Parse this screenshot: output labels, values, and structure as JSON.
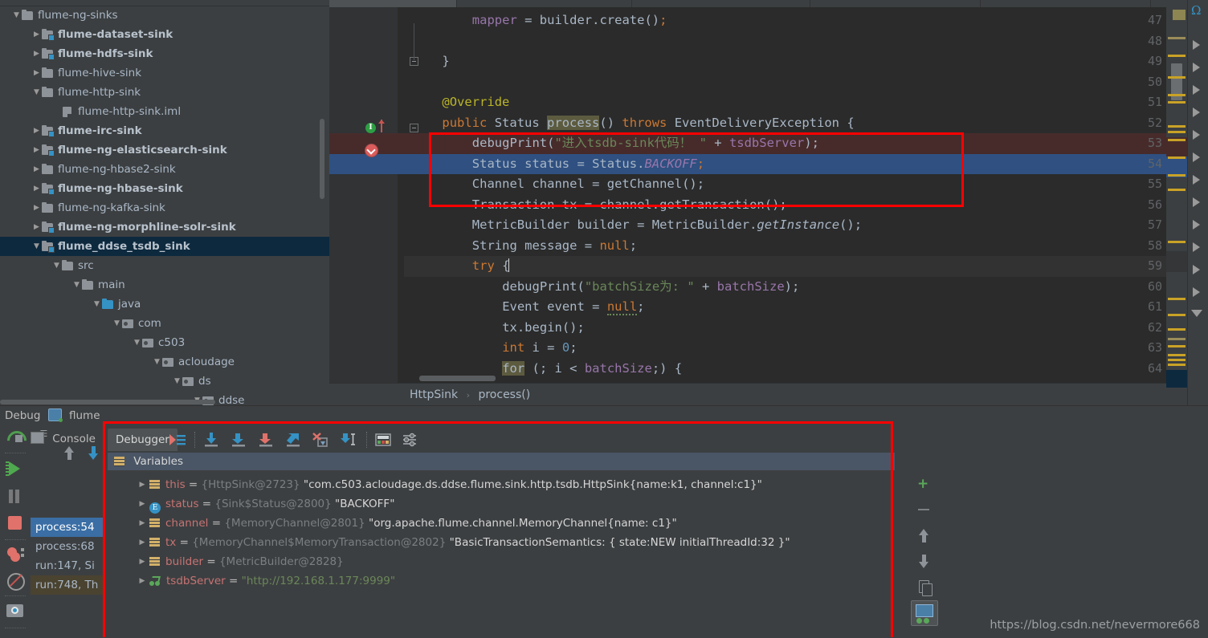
{
  "project_tree": {
    "items": [
      {
        "label": "flume-ng-sinks",
        "indent": 0,
        "twisty": "▼",
        "icon": "folder",
        "bold": false
      },
      {
        "label": "flume-dataset-sink",
        "indent": 1,
        "twisty": "▶",
        "icon": "module",
        "bold": true
      },
      {
        "label": "flume-hdfs-sink",
        "indent": 1,
        "twisty": "▶",
        "icon": "module",
        "bold": true
      },
      {
        "label": "flume-hive-sink",
        "indent": 1,
        "twisty": "▶",
        "icon": "folder",
        "bold": false
      },
      {
        "label": "flume-http-sink",
        "indent": 1,
        "twisty": "▼",
        "icon": "folder",
        "bold": false
      },
      {
        "label": "flume-http-sink.iml",
        "indent": 2,
        "twisty": "",
        "icon": "iml",
        "bold": false
      },
      {
        "label": "flume-irc-sink",
        "indent": 1,
        "twisty": "▶",
        "icon": "module",
        "bold": true
      },
      {
        "label": "flume-ng-elasticsearch-sink",
        "indent": 1,
        "twisty": "▶",
        "icon": "module",
        "bold": true
      },
      {
        "label": "flume-ng-hbase2-sink",
        "indent": 1,
        "twisty": "▶",
        "icon": "folder",
        "bold": false
      },
      {
        "label": "flume-ng-hbase-sink",
        "indent": 1,
        "twisty": "▶",
        "icon": "module",
        "bold": true
      },
      {
        "label": "flume-ng-kafka-sink",
        "indent": 1,
        "twisty": "▶",
        "icon": "folder",
        "bold": false
      },
      {
        "label": "flume-ng-morphline-solr-sink",
        "indent": 1,
        "twisty": "▶",
        "icon": "module",
        "bold": true
      },
      {
        "label": "flume_ddse_tsdb_sink",
        "indent": 1,
        "twisty": "▼",
        "icon": "module",
        "bold": true,
        "selected": true
      },
      {
        "label": "src",
        "indent": 2,
        "twisty": "▼",
        "icon": "folder",
        "bold": false
      },
      {
        "label": "main",
        "indent": 3,
        "twisty": "▼",
        "icon": "folder",
        "bold": false
      },
      {
        "label": "java",
        "indent": 4,
        "twisty": "▼",
        "icon": "source-folder",
        "bold": false
      },
      {
        "label": "com",
        "indent": 5,
        "twisty": "▼",
        "icon": "package",
        "bold": false
      },
      {
        "label": "c503",
        "indent": 6,
        "twisty": "▼",
        "icon": "package",
        "bold": false
      },
      {
        "label": "acloudage",
        "indent": 7,
        "twisty": "▼",
        "icon": "package",
        "bold": false
      },
      {
        "label": "ds",
        "indent": 8,
        "twisty": "▼",
        "icon": "package",
        "bold": false
      },
      {
        "label": "ddse",
        "indent": 9,
        "twisty": "▼",
        "icon": "package",
        "bold": false
      }
    ]
  },
  "editor": {
    "lines": [
      {
        "num": "47",
        "indent": 8,
        "tokens": [
          {
            "t": "mapper",
            "c": "fld"
          },
          {
            "t": " = builder.",
            "c": ""
          },
          {
            "t": "create",
            "c": ""
          },
          {
            "t": "()",
            "c": ""
          },
          {
            "t": ";",
            "c": "kw"
          }
        ]
      },
      {
        "num": "48",
        "indent": 0,
        "tokens": []
      },
      {
        "num": "49",
        "indent": 4,
        "tokens": [
          {
            "t": "}",
            "c": ""
          }
        ]
      },
      {
        "num": "50",
        "indent": 0,
        "tokens": []
      },
      {
        "num": "51",
        "indent": 4,
        "tokens": [
          {
            "t": "@Override",
            "c": "anno"
          }
        ]
      },
      {
        "num": "52",
        "indent": 4,
        "tokens": [
          {
            "t": "public",
            "c": "kw"
          },
          {
            "t": " Status ",
            "c": ""
          },
          {
            "t": "process",
            "c": "hl"
          },
          {
            "t": "() ",
            "c": ""
          },
          {
            "t": "throws",
            "c": "kw"
          },
          {
            "t": " EventDeliveryException {",
            "c": ""
          }
        ]
      },
      {
        "num": "53",
        "indent": 8,
        "tokens": [
          {
            "t": "debugPrint(",
            "c": ""
          },
          {
            "t": "\"进入tsdb-sink代码！ \"",
            "c": "str"
          },
          {
            "t": " + ",
            "c": ""
          },
          {
            "t": "tsdbServer",
            "c": "fld"
          },
          {
            "t": ");",
            "c": ""
          }
        ]
      },
      {
        "num": "54",
        "indent": 8,
        "tokens": [
          {
            "t": "Status status = Status.",
            "c": ""
          },
          {
            "t": "BACKOFF",
            "c": "stat"
          },
          {
            "t": ";",
            "c": "kw"
          }
        ]
      },
      {
        "num": "55",
        "indent": 8,
        "tokens": [
          {
            "t": "Channel channel = getChannel();",
            "c": ""
          }
        ]
      },
      {
        "num": "56",
        "indent": 8,
        "tokens": [
          {
            "t": "Transaction tx = channel.getTransaction();",
            "c": ""
          }
        ]
      },
      {
        "num": "57",
        "indent": 8,
        "tokens": [
          {
            "t": "MetricBuilder builder = MetricBuilder.",
            "c": ""
          },
          {
            "t": "getInstance",
            "c": "ital"
          },
          {
            "t": "();",
            "c": ""
          }
        ]
      },
      {
        "num": "58",
        "indent": 8,
        "tokens": [
          {
            "t": "String message = ",
            "c": ""
          },
          {
            "t": "null",
            "c": "kw"
          },
          {
            "t": ";",
            "c": ""
          }
        ]
      },
      {
        "num": "59",
        "indent": 8,
        "tokens": [
          {
            "t": "try",
            "c": "kw"
          },
          {
            "t": " {",
            "c": "caret"
          }
        ]
      },
      {
        "num": "60",
        "indent": 12,
        "tokens": [
          {
            "t": "debugPrint(",
            "c": ""
          },
          {
            "t": "\"batchSize为: \"",
            "c": "str"
          },
          {
            "t": " + ",
            "c": ""
          },
          {
            "t": "batchSize",
            "c": "fld"
          },
          {
            "t": ");",
            "c": ""
          }
        ]
      },
      {
        "num": "61",
        "indent": 12,
        "tokens": [
          {
            "t": "Event event = ",
            "c": ""
          },
          {
            "t": "null",
            "c": "sq"
          },
          {
            "t": ";",
            "c": ""
          }
        ]
      },
      {
        "num": "62",
        "indent": 12,
        "tokens": [
          {
            "t": "tx.begin();",
            "c": ""
          }
        ]
      },
      {
        "num": "63",
        "indent": 12,
        "tokens": [
          {
            "t": "int",
            "c": "kw"
          },
          {
            "t": " i = ",
            "c": ""
          },
          {
            "t": "0",
            "c": "num"
          },
          {
            "t": ";",
            "c": ""
          }
        ]
      },
      {
        "num": "64",
        "indent": 12,
        "tokens": [
          {
            "t": "for",
            "c": "hl"
          },
          {
            "t": " (; i < ",
            "c": ""
          },
          {
            "t": "batchSize",
            "c": "fld"
          },
          {
            "t": ";) {",
            "c": ""
          }
        ]
      }
    ],
    "execution_line": "54",
    "breakpoint_line": "53",
    "caret_line": "59",
    "breadcrumb": {
      "class": "HttpSink",
      "separator": "›",
      "method": "process()"
    }
  },
  "debug": {
    "title": "Debug",
    "config_name": "flume",
    "tabs": {
      "console": "Console",
      "debugger": "Debugger"
    },
    "frames": [
      {
        "label": "process:54",
        "state": "selected"
      },
      {
        "label": "process:68",
        "state": "normal"
      },
      {
        "label": "run:147, Si",
        "state": "normal"
      },
      {
        "label": "run:748, Th",
        "state": "library"
      }
    ],
    "variables_title": "Variables",
    "variables": [
      {
        "name": "this",
        "icon": "object-icon",
        "ref": "{HttpSink@2723}",
        "value": "\"com.c503.acloudage.ds.ddse.flume.sink.http.tsdb.HttpSink{name:k1, channel:c1}\"",
        "value_color": "white"
      },
      {
        "name": "status",
        "icon": "enum-icon",
        "ref": "{Sink$Status@2800}",
        "value": "\"BACKOFF\"",
        "value_color": "white"
      },
      {
        "name": "channel",
        "icon": "object-icon",
        "ref": "{MemoryChannel@2801}",
        "value": "\"org.apache.flume.channel.MemoryChannel{name: c1}\"",
        "value_color": "white"
      },
      {
        "name": "tx",
        "icon": "object-icon",
        "ref": "{MemoryChannel$MemoryTransaction@2802}",
        "value": "\"BasicTransactionSemantics: { state:NEW initialThreadId:32 }\"",
        "value_color": "white"
      },
      {
        "name": "builder",
        "icon": "object-icon",
        "ref": "{MetricBuilder@2828}",
        "value": "",
        "value_color": "white"
      },
      {
        "name": "tsdbServer",
        "icon": "watch-icon",
        "ref": "",
        "value": "\"http://192.168.1.177:9999\"",
        "value_color": "green"
      }
    ],
    "toolbar_icons": [
      "show-execution-point-icon",
      "step-over-icon",
      "step-into-icon",
      "force-step-into-icon",
      "step-out-icon",
      "drop-frame-icon",
      "run-to-cursor-icon",
      "evaluate-expression-icon",
      "settings-icon"
    ],
    "sidebar_icons": [
      "rerun-icon",
      "resume-program-icon",
      "pause-program-icon",
      "stop-icon",
      "view-breakpoints-icon",
      "mute-breakpoints-icon",
      "settings-camera-icon"
    ],
    "frames_toolbar_icons": [
      "frame-up-icon",
      "frame-down-icon",
      "filter-icon"
    ],
    "watch_toolbar_icons": [
      "add-watch-icon",
      "remove-watch-icon",
      "move-up-icon",
      "move-down-icon",
      "copy-icon",
      "watches-icon"
    ]
  },
  "watermark": "https://blog.csdn.net/nevermore668",
  "colors": {
    "accent_blue": "#3592c4",
    "selection_blue": "#2f5081",
    "breakpoint_red": "#db5c5c",
    "annotation_red": "#ff0000",
    "string_green": "#6a8759",
    "keyword_orange": "#cc7832",
    "panel_bg": "#3c3f41",
    "editor_bg": "#2b2b2b"
  }
}
